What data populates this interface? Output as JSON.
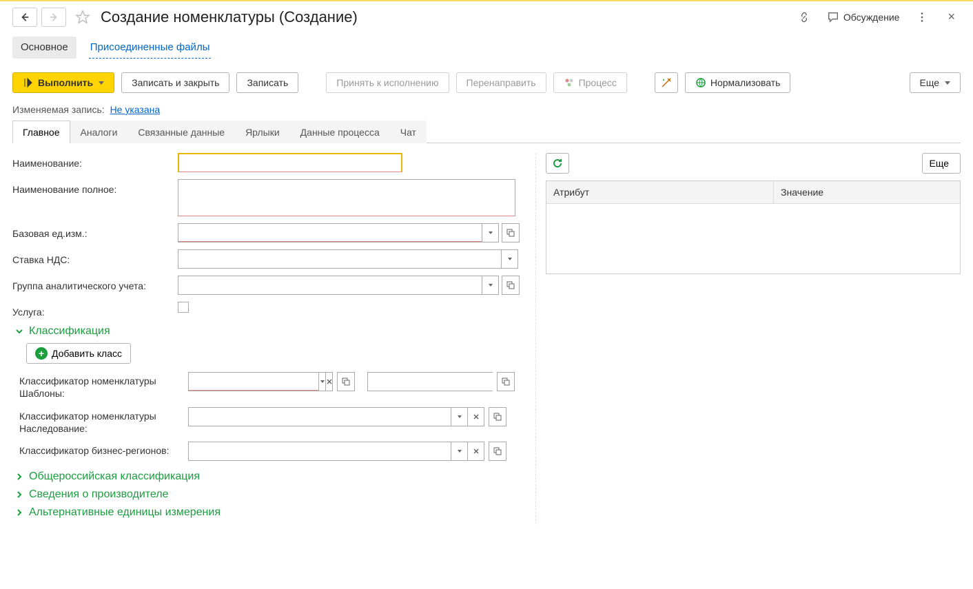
{
  "header": {
    "title": "Создание номенклатуры (Создание)",
    "discuss_label": "Обсуждение"
  },
  "subnav": {
    "main": "Основное",
    "attachments": "Присоединенные файлы"
  },
  "toolbar": {
    "execute": "Выполнить",
    "save_close": "Записать и закрыть",
    "save": "Записать",
    "accept": "Принять к исполнению",
    "redirect": "Перенаправить",
    "process": "Процесс",
    "normalize": "Нормализовать",
    "more": "Еще"
  },
  "info": {
    "label": "Изменяемая запись:",
    "link": "Не указана"
  },
  "tabs": [
    "Главное",
    "Аналоги",
    "Связанные данные",
    "Ярлыки",
    "Данные процесса",
    "Чат"
  ],
  "form": {
    "name_label": "Наименование:",
    "full_name_label": "Наименование полное:",
    "base_unit_label": "Базовая ед.изм.:",
    "vat_rate_label": "Ставка НДС:",
    "analytic_group_label": "Группа аналитического учета:",
    "service_label": "Услуга:"
  },
  "sections": {
    "classification": "Классификация",
    "add_class": "Добавить класс",
    "classifier_templates": "Классификатор номенклатуры Шаблоны:",
    "classifier_inherit": "Классификатор номенклатуры Наследование:",
    "classifier_regions": "Классификатор бизнес-регионов:",
    "ru_classification": "Общероссийская классификация",
    "manufacturer": "Сведения о производителе",
    "alt_units": "Альтернативные единицы измерения"
  },
  "right_panel": {
    "more": "Еще",
    "attr_header": "Атрибут",
    "value_header": "Значение"
  }
}
